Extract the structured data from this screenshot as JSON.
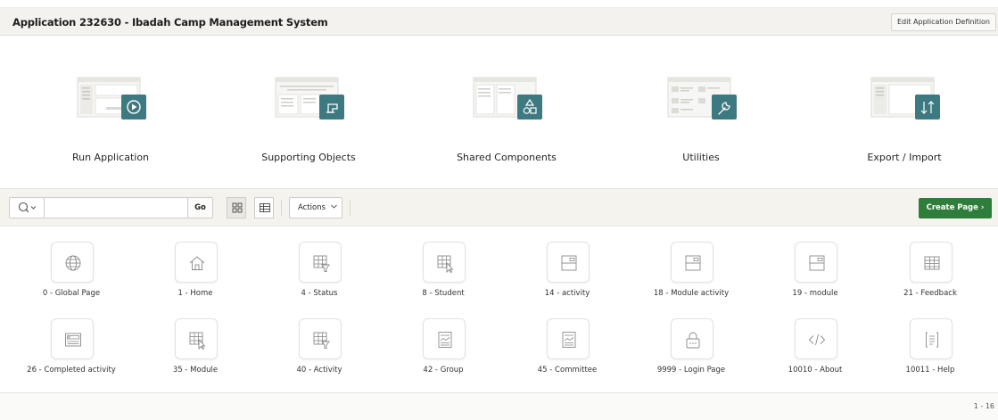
{
  "header": {
    "title": "Application 232630 - Ibadah Camp Management System",
    "edit_button": "Edit Application Definition"
  },
  "tiles": [
    {
      "label": "Run Application",
      "icon": "play-icon"
    },
    {
      "label": "Supporting Objects",
      "icon": "install-icon"
    },
    {
      "label": "Shared Components",
      "icon": "shapes-icon"
    },
    {
      "label": "Utilities",
      "icon": "wrench-icon"
    },
    {
      "label": "Export / Import",
      "icon": "transfer-icon"
    }
  ],
  "toolbar": {
    "search_placeholder": "",
    "go_label": "Go",
    "actions_label": "Actions",
    "create_label": "Create Page"
  },
  "pages": [
    {
      "label": "0 - Global Page",
      "icon": "globe-icon"
    },
    {
      "label": "1 - Home",
      "icon": "home-icon"
    },
    {
      "label": "4 - Status",
      "icon": "grid-filter-icon"
    },
    {
      "label": "8 - Student",
      "icon": "grid-cursor-icon"
    },
    {
      "label": "14 - activity",
      "icon": "form-icon"
    },
    {
      "label": "18 - Module activity",
      "icon": "form-icon"
    },
    {
      "label": "19 - module",
      "icon": "form-icon"
    },
    {
      "label": "21 - Feedback",
      "icon": "table-icon"
    },
    {
      "label": "26 - Completed activity",
      "icon": "search-form-icon"
    },
    {
      "label": "35 - Module",
      "icon": "grid-cursor-icon"
    },
    {
      "label": "40 - Activity",
      "icon": "grid-filter-icon"
    },
    {
      "label": "42 - Group",
      "icon": "document-chart-icon"
    },
    {
      "label": "45 - Committee",
      "icon": "document-chart-icon"
    },
    {
      "label": "9999 - Login Page",
      "icon": "lock-icon"
    },
    {
      "label": "10010 - About",
      "icon": "code-icon"
    },
    {
      "label": "10011 - Help",
      "icon": "help-doc-icon"
    }
  ],
  "footer": {
    "count": "1 - 16"
  },
  "colors": {
    "accent_teal": "#3d7980",
    "create_green": "#2e7d3b"
  }
}
